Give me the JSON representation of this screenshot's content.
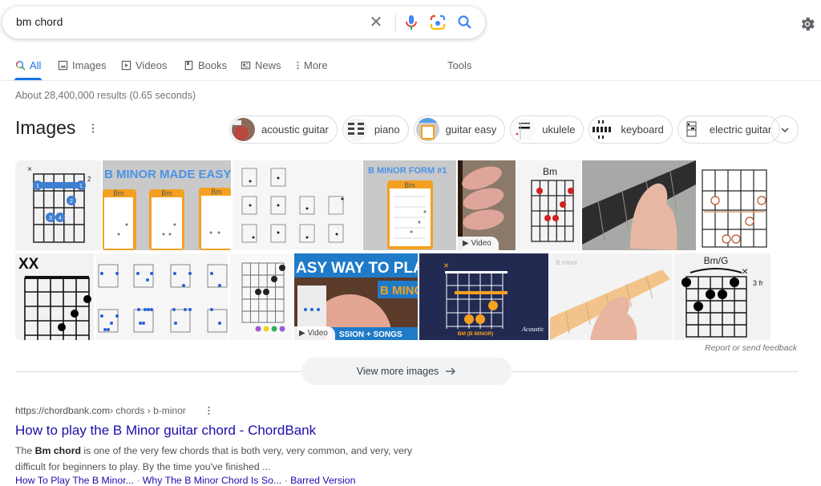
{
  "search": {
    "query": "bm chord",
    "clear_icon": "close-icon",
    "voice_icon": "mic-icon",
    "lens_icon": "camera-lens-icon",
    "search_icon": "search-icon"
  },
  "settings_icon": "gear-icon",
  "tabs": [
    {
      "label": "All",
      "icon": "search-icon",
      "active": true
    },
    {
      "label": "Images",
      "icon": "image-icon"
    },
    {
      "label": "Videos",
      "icon": "play-icon"
    },
    {
      "label": "Books",
      "icon": "book-icon"
    },
    {
      "label": "News",
      "icon": "news-icon"
    },
    {
      "label": "More",
      "icon": "kebab-icon"
    }
  ],
  "tools_label": "Tools",
  "result_stats": "About 28,400,000 results (0.65 seconds)",
  "images_section": {
    "title": "Images",
    "chips": [
      {
        "label": "acoustic guitar"
      },
      {
        "label": "piano"
      },
      {
        "label": "guitar easy"
      },
      {
        "label": "ukulele"
      },
      {
        "label": "keyboard"
      },
      {
        "label": "electric guitar"
      }
    ],
    "thumbs": {
      "t2_title": "B MINOR MADE EASY",
      "bm": "Bm",
      "t4_title": "B MINOR FORM #1",
      "video_label": "Video",
      "t11_title": "ASY WAY TO PLA",
      "t11_sub": "B MINO",
      "t11_bottom": "SSION + SONGS",
      "t12_caption": "BM (B MINOR)",
      "t12_brand": "Acoustic",
      "t13_label": "B minor",
      "t14_title": "Bm/G",
      "t14_fret": "3 fr",
      "xx": "XX"
    },
    "report_feedback": "Report or send feedback",
    "view_more": "View more images"
  },
  "result": {
    "cite_domain": "https://chordbank.com",
    "cite_path": " › chords › b-minor",
    "title": "How to play the B Minor guitar chord - ChordBank",
    "snippet_pre": "The ",
    "snippet_bold": "Bm chord",
    "snippet_post": " is one of the very few chords that is both very, very common, and very, very difficult for beginners to play. By the time you've finished ...",
    "sitelinks": [
      "How To Play The B Minor...",
      "Why The B Minor Chord Is So...",
      "Barred Version"
    ],
    "sitelink_separator": " · "
  }
}
